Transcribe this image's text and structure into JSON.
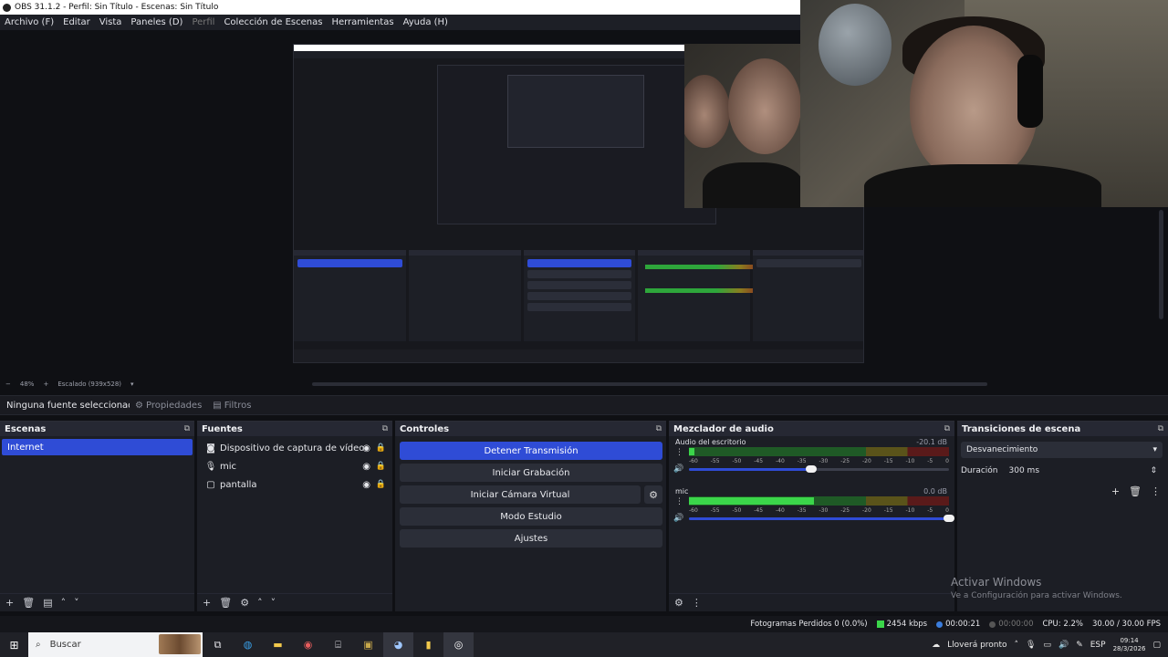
{
  "window": {
    "title": "OBS 31.1.2 - Perfil: Sin Título - Escenas: Sin Título"
  },
  "menu": [
    {
      "label": "Archivo (F)",
      "dim": false
    },
    {
      "label": "Editar",
      "dim": false
    },
    {
      "label": "Vista",
      "dim": false
    },
    {
      "label": "Paneles (D)",
      "dim": false
    },
    {
      "label": "Perfil",
      "dim": true
    },
    {
      "label": "Colección de Escenas",
      "dim": false
    },
    {
      "label": "Herramientas",
      "dim": false
    },
    {
      "label": "Ayuda (H)",
      "dim": false
    }
  ],
  "zoom": {
    "percent": "48%",
    "scaling": "Escalado (939x528)"
  },
  "context": {
    "no_selection": "Ninguna fuente seleccionada",
    "properties": "Propiedades",
    "filters": "Filtros"
  },
  "scenes": {
    "title": "Escenas",
    "items": [
      "Internet"
    ]
  },
  "sources": {
    "title": "Fuentes",
    "items": [
      {
        "label": "Dispositivo de captura de vídeo",
        "icon": "camera-icon"
      },
      {
        "label": "mic",
        "icon": "microphone-icon"
      },
      {
        "label": "pantalla",
        "icon": "monitor-icon"
      }
    ]
  },
  "controls": {
    "title": "Controles",
    "stop_stream": "Detener Transmisión",
    "start_recording": "Iniciar Grabación",
    "start_virtual_camera": "Iniciar Cámara Virtual",
    "studio_mode": "Modo Estudio",
    "settings": "Ajustes"
  },
  "mixer": {
    "title": "Mezclador de audio",
    "channels": [
      {
        "name": "Audio del escritorio",
        "db": "-20.1 dB",
        "level": 0.02,
        "volume": 0.47
      },
      {
        "name": "mic",
        "db": "0.0 dB",
        "level": 0.48,
        "volume": 1.0
      }
    ],
    "ticks": [
      "-60",
      "-55",
      "-50",
      "-45",
      "-40",
      "-35",
      "-30",
      "-25",
      "-20",
      "-15",
      "-10",
      "-5",
      "0"
    ]
  },
  "transitions": {
    "title": "Transiciones de escena",
    "selected": "Desvanecimiento",
    "duration_label": "Duración",
    "duration_value": "300 ms"
  },
  "watermark": {
    "title": "Activar Windows",
    "subtitle": "Ve a Configuración para activar Windows."
  },
  "status": {
    "dropped": "Fotogramas Perdidos 0 (0.0%)",
    "bitrate": "2454 kbps",
    "stream_time": "00:00:21",
    "record_time": "00:00:00",
    "cpu": "CPU: 2.2%",
    "fps": "30.00 / 30.00 FPS"
  },
  "taskbar": {
    "search_placeholder": "Buscar",
    "weather": "Lloverá pronto",
    "language": "ESP",
    "time": "09:14",
    "date": "28/3/2026"
  },
  "colors": {
    "accent": "#2f4cd6",
    "panel": "#1c1e25",
    "background": "#0f1014",
    "meter_green": "#3bd64a"
  }
}
